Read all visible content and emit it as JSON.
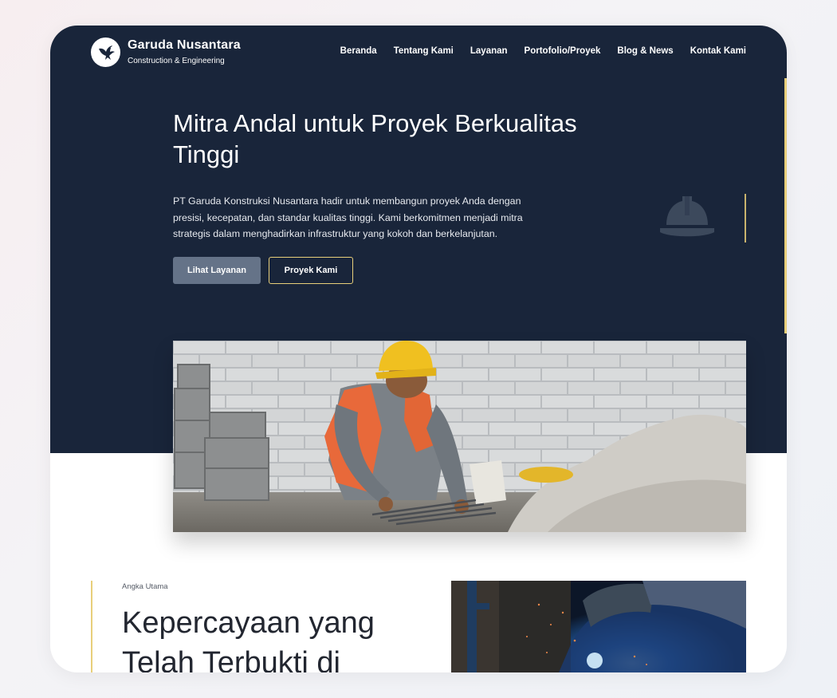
{
  "header": {
    "brand_name": "Garuda Nusantara",
    "brand_tagline": "Construction & Engineering",
    "logo_icon": "garuda-bird-icon"
  },
  "nav": {
    "items": [
      {
        "label": "Beranda"
      },
      {
        "label": "Tentang Kami"
      },
      {
        "label": "Layanan"
      },
      {
        "label": "Portofolio/Proyek"
      },
      {
        "label": "Blog & News"
      },
      {
        "label": "Kontak Kami"
      }
    ]
  },
  "hero": {
    "title": "Mitra Andal untuk Proyek Berkualitas Tinggi",
    "description": "PT Garuda Konstruksi Nusantara hadir untuk membangun proyek Anda dengan presisi, kecepatan, dan standar kualitas tinggi. Kami berkomitmen menjadi mitra strategis dalam menghadirkan infrastruktur yang kokoh dan berkelanjutan.",
    "primary_button": "Lihat Layanan",
    "secondary_button": "Proyek Kami",
    "decor_icon": "hard-hat-icon",
    "image_subject": "construction-worker-photo"
  },
  "stats": {
    "eyebrow": "Angka Utama",
    "title": "Kepercayaan yang Telah Terbukti di",
    "image_subject": "welding-photo"
  },
  "colors": {
    "hero_bg": "#19253a",
    "accent_gold": "#e8cf7a",
    "button_slate": "#657388",
    "page_bg": "#ffffff"
  }
}
